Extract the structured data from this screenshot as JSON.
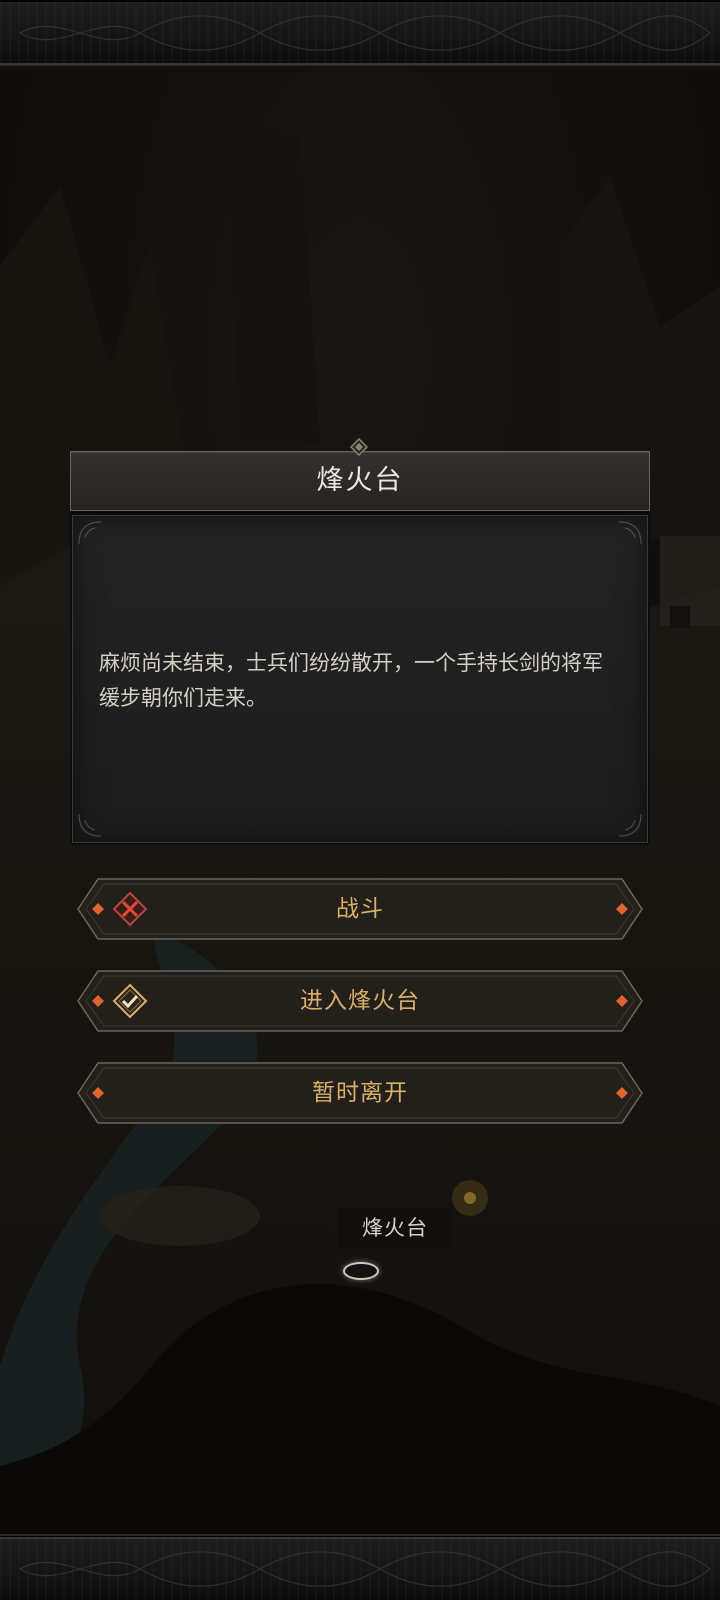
{
  "map": {
    "location_label": "烽火台"
  },
  "dialog": {
    "title": "烽火台",
    "text": "麻烦尚未结束，士兵们纷纷散开，一个手持长剑的将军缓步朝你们走来。"
  },
  "options": [
    {
      "label": "战斗",
      "icon": "crossed-swords-x-icon"
    },
    {
      "label": "进入烽火台",
      "icon": "check-diamond-icon"
    },
    {
      "label": "暂时离开",
      "icon": ""
    }
  ],
  "colors": {
    "option_text": "#d9b06a",
    "accent_gem": "#e0632e",
    "frame_line": "#6b6559"
  }
}
